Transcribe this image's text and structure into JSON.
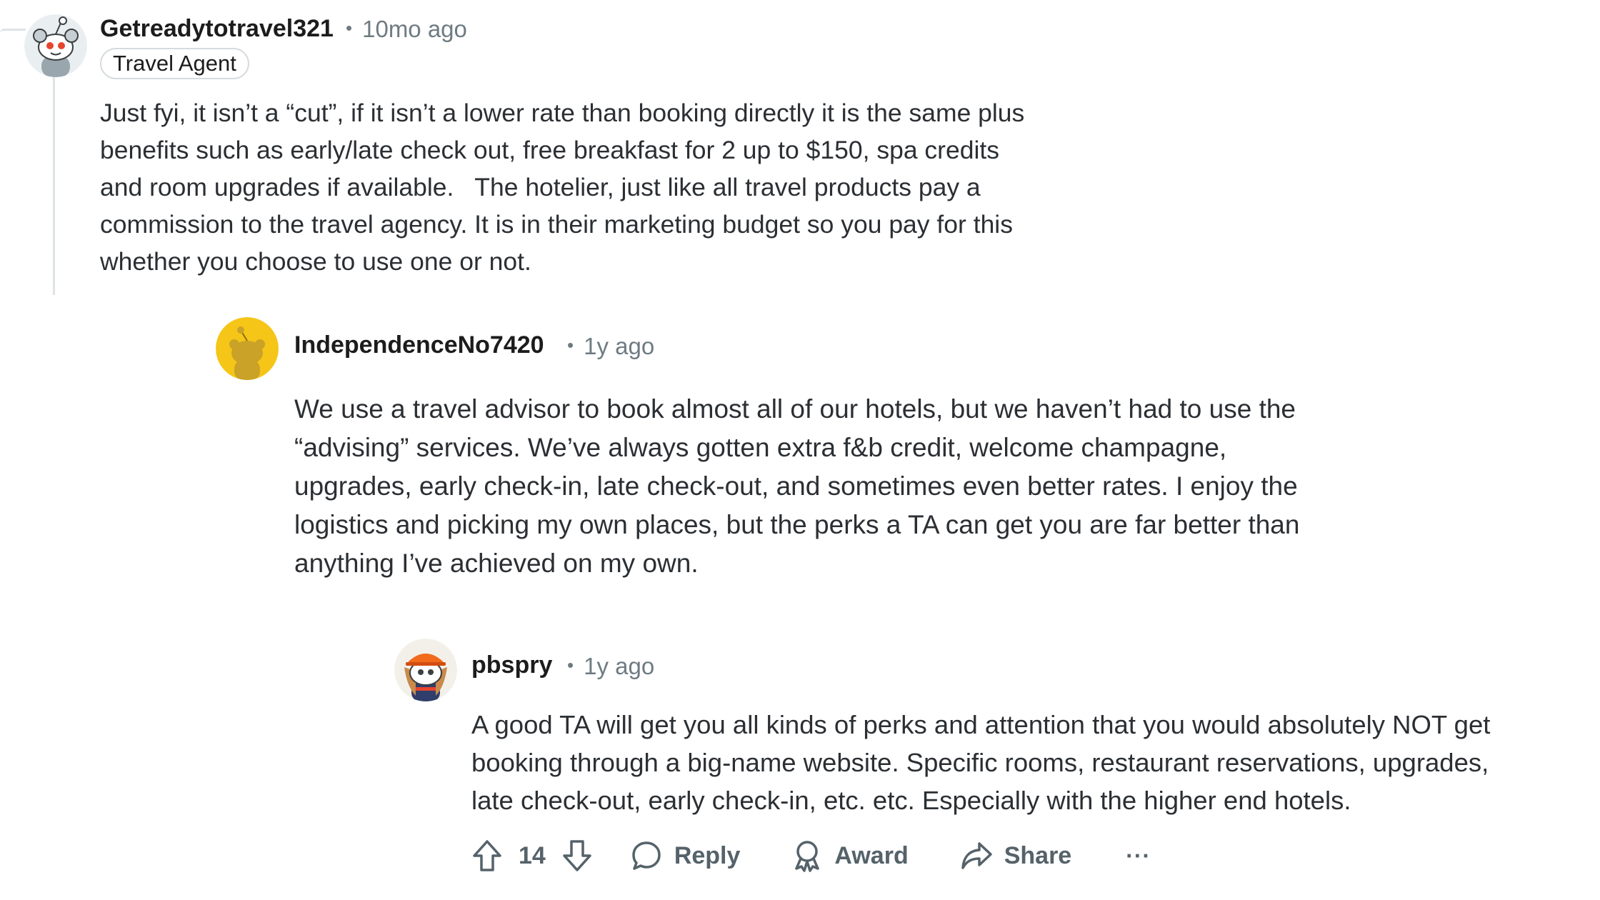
{
  "comments": [
    {
      "username": "Getreadytotravel321",
      "age": "10mo ago",
      "flair": "Travel Agent",
      "avatar_icon": "snoo-avatar-gray",
      "body": "Just fyi, it isn’t a “cut”, if it isn’t a lower rate than booking directly it is the same plus\nbenefits such as early/late check out, free breakfast for 2 up to $150, spa credits\nand room upgrades if available.   The hotelier, just like all travel products pay a\ncommission to the travel agency. It is in their marketing budget so you pay for this\nwhether you choose to use one or not."
    },
    {
      "username": "IndependenceNo7420",
      "age": "1y ago",
      "avatar_icon": "snoo-avatar-yellow",
      "body": "We use a travel advisor to book almost all of our hotels, but we haven’t had to use the\n“advising” services. We’ve always gotten extra f&b credit, welcome champagne,\nupgrades, early check-in, late check-out, and sometimes even better rates. I enjoy the\nlogistics and picking my own places, but the perks a TA can get you are far better than\nanything I’ve achieved on my own."
    },
    {
      "username": "pbspry",
      "age": "1y ago",
      "avatar_icon": "snoo-avatar-orange-hat",
      "body": "A good TA will get you all kinds of perks and attention that you would absolutely NOT get\nbooking through a big-name website. Specific rooms, restaurant reservations, upgrades,\nlate check-out, early check-in, etc. etc. Especially with the higher end hotels."
    }
  ],
  "actions": {
    "vote_count": "14",
    "reply_label": "Reply",
    "award_label": "Award",
    "share_label": "Share",
    "more_label": "···"
  },
  "colors": {
    "text": "#1c1c1c",
    "meta": "#6e7b82",
    "thread_line": "#dfe3e6",
    "action": "#55626a",
    "yellow_avatar": "#f5c518"
  }
}
